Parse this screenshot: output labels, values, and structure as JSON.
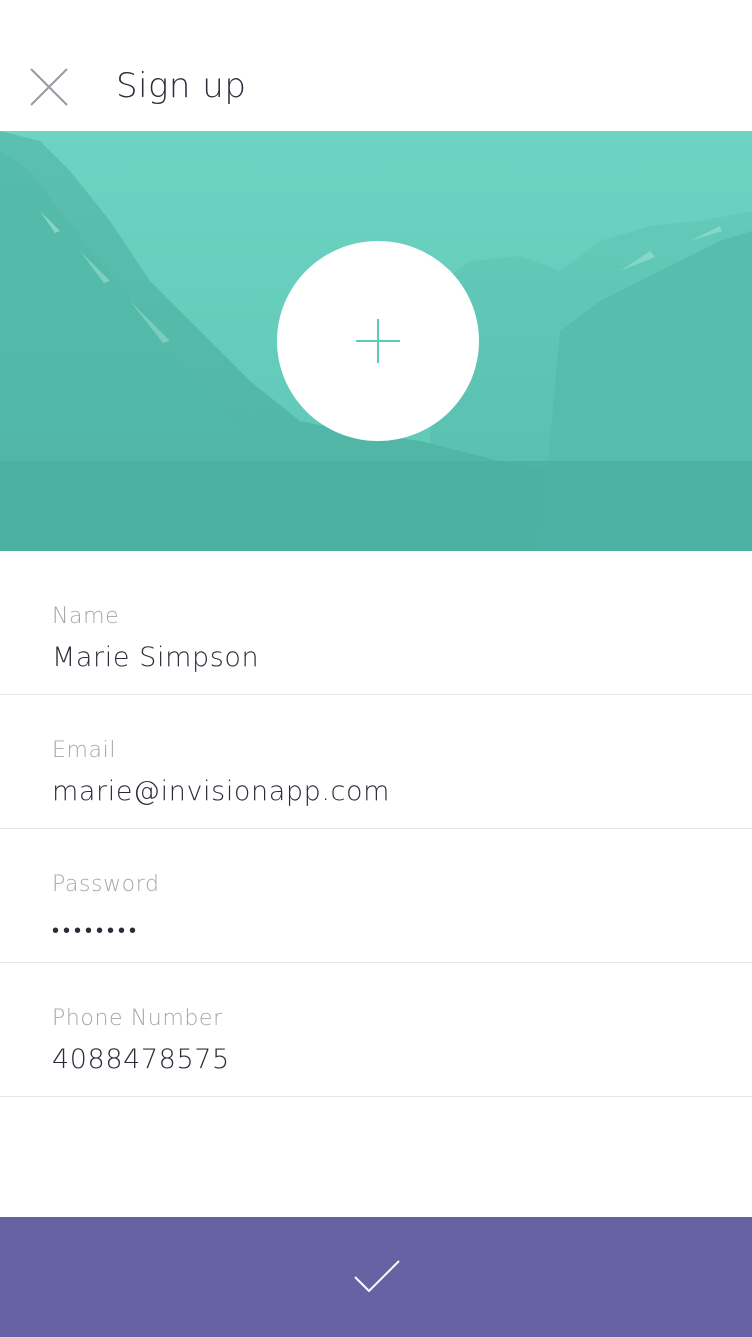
{
  "header": {
    "title": "Sign up",
    "close_icon": "close-icon"
  },
  "hero": {
    "avatar_icon": "plus-icon"
  },
  "form": {
    "fields": [
      {
        "label": "Name",
        "value": "Marie Simpson"
      },
      {
        "label": "Email",
        "value": "marie@invisionapp.com"
      },
      {
        "label": "Password",
        "value": "••••••••"
      },
      {
        "label": "Phone Number",
        "value": "4088478575"
      }
    ]
  },
  "submit": {
    "icon": "check-icon"
  },
  "colors": {
    "accent_teal": "#5ec9b8",
    "submit_purple": "#6663a5",
    "text_dark": "#2b2b3a",
    "label_gray": "#a5a5ad"
  }
}
